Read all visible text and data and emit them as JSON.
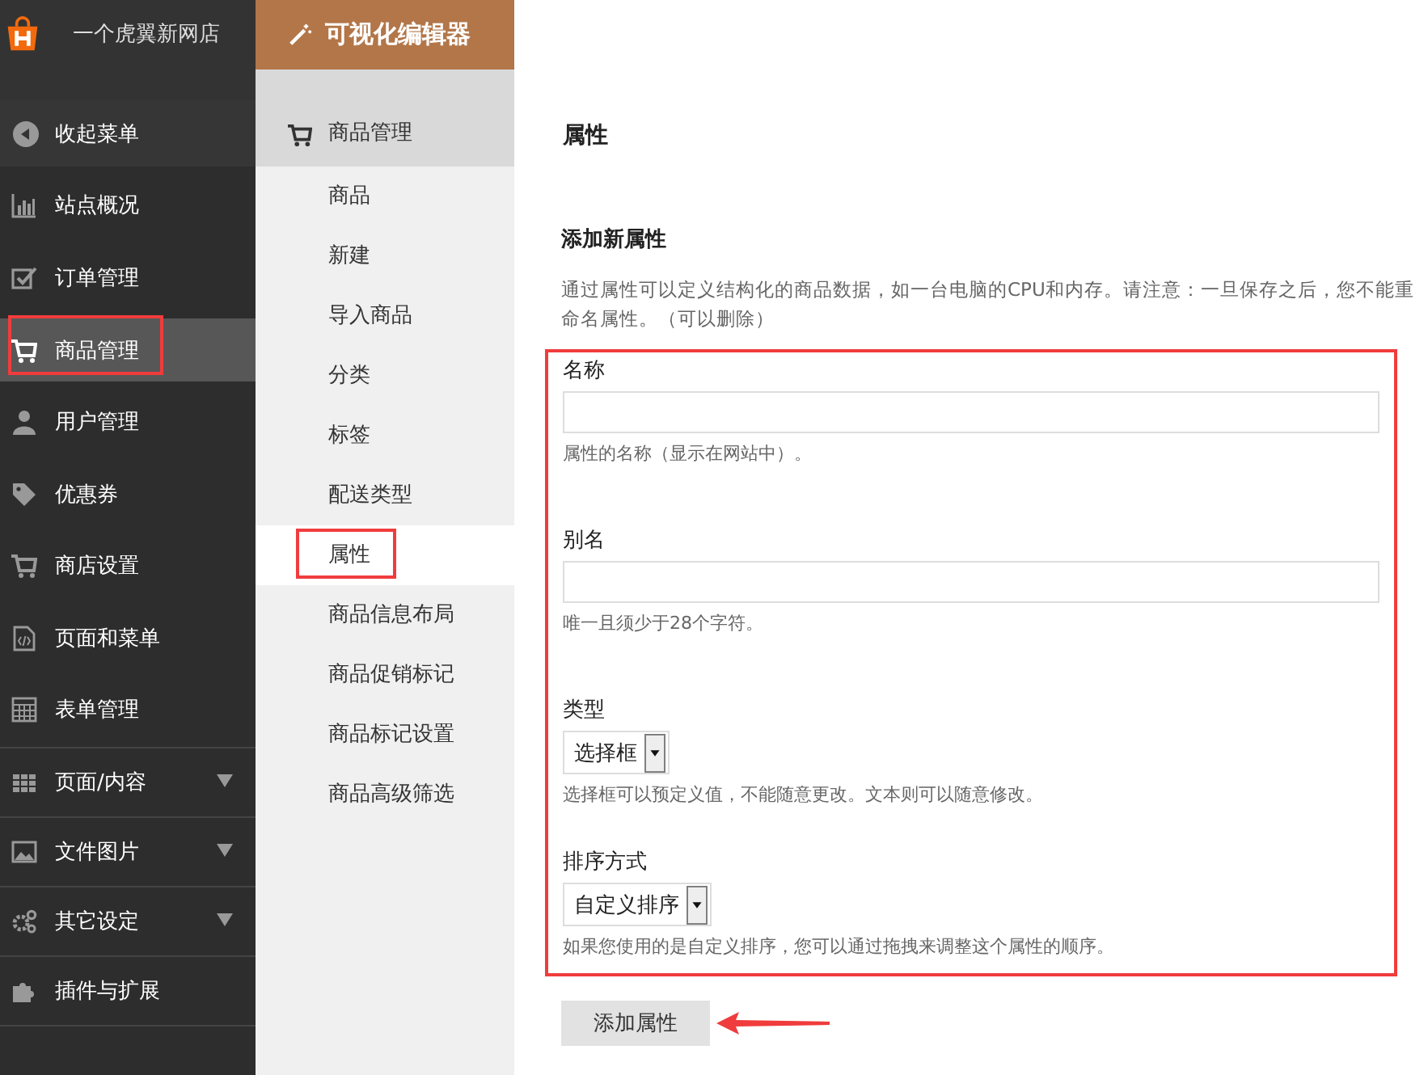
{
  "store": {
    "name": "一个虎翼新网店"
  },
  "editor_tab": {
    "label": "可视化编辑器"
  },
  "sidebar": {
    "collapse": "收起菜单",
    "items": [
      {
        "label": "站点概况",
        "selected": false,
        "highlighted": false
      },
      {
        "label": "订单管理",
        "selected": false,
        "highlighted": false
      },
      {
        "label": "商品管理",
        "selected": true,
        "highlighted": true
      },
      {
        "label": "用户管理",
        "selected": false,
        "highlighted": false
      },
      {
        "label": "优惠券",
        "selected": false,
        "highlighted": false
      },
      {
        "label": "商店设置",
        "selected": false,
        "highlighted": false
      },
      {
        "label": "页面和菜单",
        "selected": false,
        "highlighted": false
      },
      {
        "label": "表单管理",
        "selected": false,
        "highlighted": false
      }
    ],
    "extra_items": [
      {
        "label": "页面/内容",
        "has_submenu": true
      },
      {
        "label": "文件图片",
        "has_submenu": true
      },
      {
        "label": "其它设定",
        "has_submenu": true
      },
      {
        "label": "插件与扩展",
        "has_submenu": false
      }
    ]
  },
  "submenu": {
    "title": "商品管理",
    "items": [
      {
        "label": "商品",
        "selected": false,
        "highlighted": false
      },
      {
        "label": "新建",
        "selected": false,
        "highlighted": false
      },
      {
        "label": "导入商品",
        "selected": false,
        "highlighted": false
      },
      {
        "label": "分类",
        "selected": false,
        "highlighted": false
      },
      {
        "label": "标签",
        "selected": false,
        "highlighted": false
      },
      {
        "label": "配送类型",
        "selected": false,
        "highlighted": false
      },
      {
        "label": "属性",
        "selected": true,
        "highlighted": true
      },
      {
        "label": "商品信息布局",
        "selected": false,
        "highlighted": false
      },
      {
        "label": "商品促销标记",
        "selected": false,
        "highlighted": false
      },
      {
        "label": "商品标记设置",
        "selected": false,
        "highlighted": false
      },
      {
        "label": "商品高级筛选",
        "selected": false,
        "highlighted": false
      }
    ]
  },
  "page": {
    "title": "属性",
    "section_title": "添加新属性",
    "description": "通过属性可以定义结构化的商品数据，如一台电脑的CPU和内存。请注意：一旦保存之后，您不能重命名属性。（可以删除）",
    "form": {
      "highlighted": true,
      "fields": [
        {
          "kind": "text",
          "label": "名称",
          "hint": "属性的名称（显示在网站中）。"
        },
        {
          "kind": "text",
          "label": "别名",
          "hint": "唯一且须少于28个字符。"
        },
        {
          "kind": "select",
          "label": "类型",
          "value": "选择框",
          "hint": "选择框可以预定义值，不能随意更改。文本则可以随意修改。"
        },
        {
          "kind": "select",
          "label": "排序方式",
          "value": "自定义排序",
          "hint": "如果您使用的是自定义排序，您可以通过拖拽来调整这个属性的顺序。"
        }
      ]
    },
    "submit": {
      "label": "添加属性",
      "pointed": true
    }
  }
}
